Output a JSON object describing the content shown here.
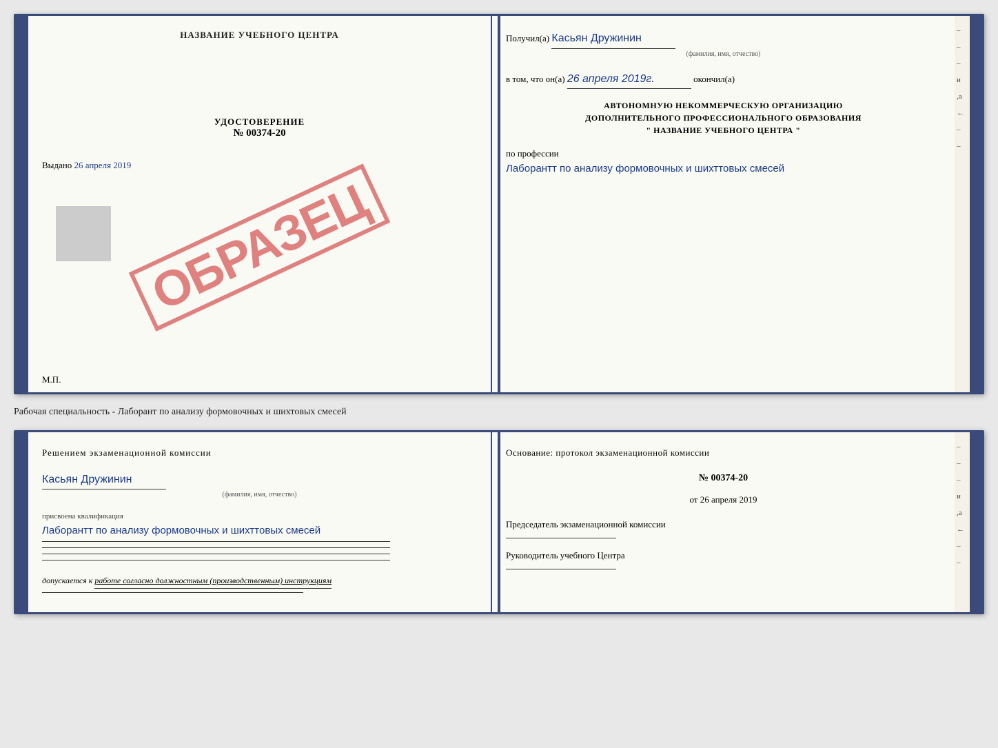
{
  "top_document": {
    "left": {
      "title": "НАЗВАНИЕ УЧЕБНОГО ЦЕНТРА",
      "cert_label": "УДОСТОВЕРЕНИЕ",
      "cert_number": "№ 00374-20",
      "issued_prefix": "Выдано",
      "issued_date": "26 апреля 2019",
      "stamp_text": "ОБРАЗЕЦ",
      "mp_label": "М.П."
    },
    "right": {
      "recipient_prefix": "Получил(а)",
      "recipient_name": "Касьян Дружинин",
      "recipient_sublabel": "(фамилия, имя, отчество)",
      "date_prefix": "в том, что он(а)",
      "date_value": "26 апреля 2019г.",
      "finished_label": "окончил(а)",
      "institution_line1": "АВТОНОМНУЮ НЕКОММЕРЧЕСКУЮ ОРГАНИЗАЦИЮ",
      "institution_line2": "ДОПОЛНИТЕЛЬНОГО ПРОФЕССИОНАЛЬНОГО ОБРАЗОВАНИЯ",
      "institution_line3": "\" НАЗВАНИЕ УЧЕБНОГО ЦЕНТРА \"",
      "profession_label": "по профессии",
      "profession_value": "Лаборантт по анализу формовочных и шихттовых смесей",
      "right_chars": [
        "–",
        "–",
        "–",
        "и",
        ",а",
        "←",
        "–",
        "–"
      ]
    }
  },
  "specialty_line": "Рабочая специальность - Лаборант по анализу формовочных и шихтовых смесей",
  "bottom_document": {
    "left": {
      "decision_title": "Решением экзаменационной комиссии",
      "name_value": "Касьян Дружинин",
      "name_sublabel": "(фамилия, имя, отчество)",
      "qualification_label": "присвоена квалификация",
      "qualification_value": "Лаборантт по анализу формовочных и шихттовых смесей",
      "allowed_prefix": "допускается к",
      "allowed_value": "работе согласно должностным (производственным) инструкциям"
    },
    "right": {
      "basis_title": "Основание: протокол экзаменационной комиссии",
      "protocol_number": "№ 00374-20",
      "date_prefix": "от",
      "date_value": "26 апреля 2019",
      "chairman_label": "Председатель экзаменационной комиссии",
      "director_label": "Руководитель учебного Центра",
      "right_chars": [
        "–",
        "–",
        "–",
        "и",
        ",а",
        "←",
        "–",
        "–"
      ]
    }
  }
}
